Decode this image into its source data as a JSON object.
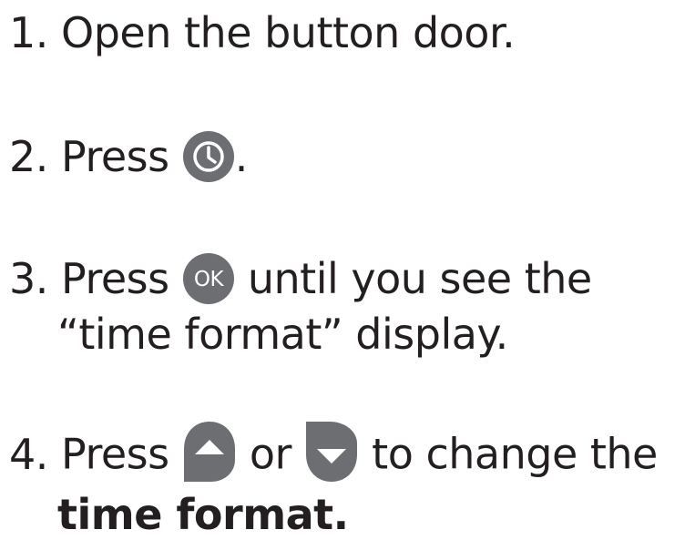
{
  "instructions": {
    "step1": {
      "number": "1.",
      "text": "Open the button door."
    },
    "step2": {
      "number": "2.",
      "text_before": "Press",
      "icon": "clock-button-icon",
      "text_after": "."
    },
    "step3": {
      "number": "3.",
      "text_before": "Press",
      "icon_label": "OK",
      "text_after": "until you see the",
      "line2": "“time format” display."
    },
    "step4": {
      "number": "4.",
      "text_before": "Press",
      "icon_up": "up-arrow-button-icon",
      "text_middle": "or",
      "icon_down": "down-arrow-button-icon",
      "text_after": "to change the",
      "line2_bold": "time format."
    }
  },
  "colors": {
    "text": "#231f20",
    "button_fill": "#6d6e71",
    "button_symbol": "#ffffff"
  }
}
